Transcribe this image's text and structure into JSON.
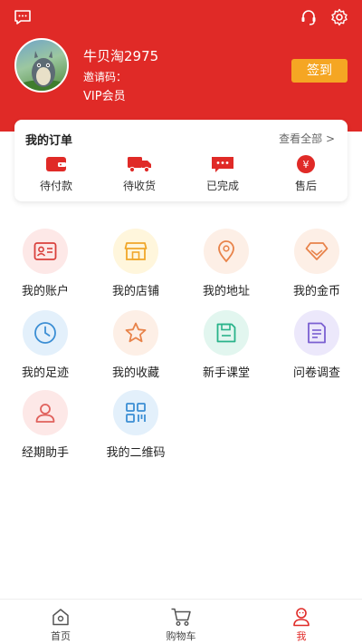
{
  "colors": {
    "brand": "#e02a27",
    "signin": "#f5a623"
  },
  "profile": {
    "username": "牛贝淘2975",
    "invite_label": "邀请码：",
    "vip_label": "VIP会员",
    "signin_label": "签到"
  },
  "orders": {
    "title": "我的订单",
    "view_all": "查看全部 >",
    "items": [
      {
        "label": "待付款",
        "icon": "wallet-icon"
      },
      {
        "label": "待收货",
        "icon": "truck-icon"
      },
      {
        "label": "已完成",
        "icon": "message-icon"
      },
      {
        "label": "售后",
        "icon": "yen-icon"
      }
    ]
  },
  "features": [
    {
      "label": "我的账户",
      "icon": "id-card-icon"
    },
    {
      "label": "我的店铺",
      "icon": "store-icon"
    },
    {
      "label": "我的地址",
      "icon": "location-icon"
    },
    {
      "label": "我的金币",
      "icon": "diamond-icon"
    },
    {
      "label": "我的足迹",
      "icon": "clock-icon"
    },
    {
      "label": "我的收藏",
      "icon": "star-icon"
    },
    {
      "label": "新手课堂",
      "icon": "save-icon"
    },
    {
      "label": "问卷调查",
      "icon": "survey-icon"
    },
    {
      "label": "经期助手",
      "icon": "person-icon"
    },
    {
      "label": "我的二维码",
      "icon": "qrcode-icon"
    }
  ],
  "tabs": [
    {
      "label": "首页",
      "icon": "home-icon"
    },
    {
      "label": "购物车",
      "icon": "cart-icon"
    },
    {
      "label": "我",
      "icon": "profile-icon"
    }
  ]
}
